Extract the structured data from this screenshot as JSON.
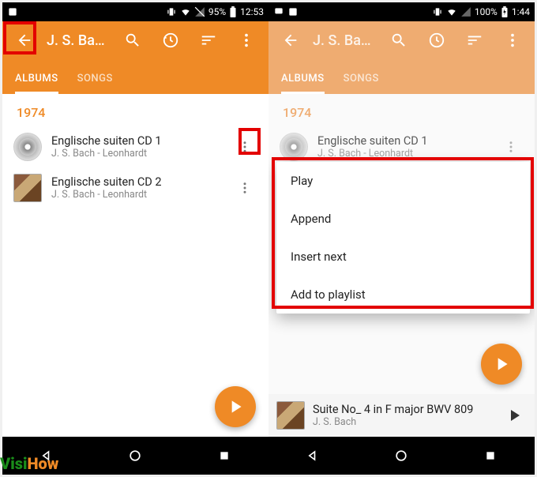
{
  "left": {
    "status": {
      "battery": "95%",
      "time": "12:53"
    },
    "title": "J. S. Bach -...",
    "tabs": {
      "albums": "ALBUMS",
      "songs": "SONGS"
    },
    "year": "1974",
    "items": [
      {
        "title": "Englische suiten CD 1",
        "sub": "J. S. Bach - Leonhardt"
      },
      {
        "title": "Englische suiten CD 2",
        "sub": "J. S. Bach - Leonhardt"
      }
    ]
  },
  "right": {
    "status": {
      "battery": "100%",
      "time": "1:44"
    },
    "title": "J. S. Bach -...",
    "tabs": {
      "albums": "ALBUMS",
      "songs": "SONGS"
    },
    "year": "1974",
    "items": [
      {
        "title": "Englische suiten CD 1",
        "sub": "J. S. Bach - Leonhardt"
      }
    ],
    "menu": [
      "Play",
      "Append",
      "Insert next",
      "Add to playlist"
    ],
    "nowplaying": {
      "title": "Suite No_ 4 in F major BWV 809",
      "sub": "J. S. Bach"
    }
  },
  "watermark": {
    "a": "Visi",
    "b": "How"
  }
}
